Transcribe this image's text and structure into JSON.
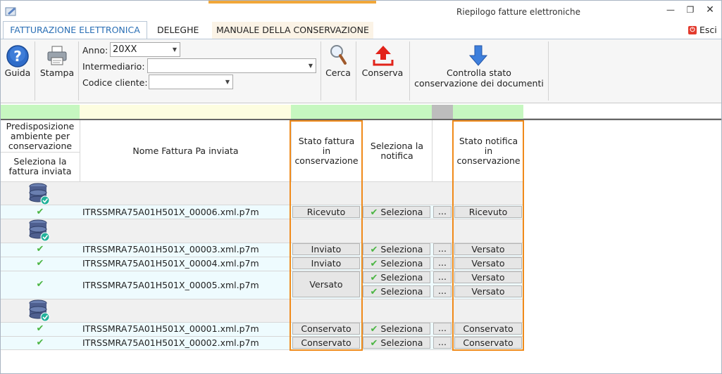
{
  "window": {
    "title": "Riepilogo fatture elettroniche"
  },
  "tabs": [
    {
      "label": "FATTURAZIONE ELETTRONICA"
    },
    {
      "label": "DELEGHE"
    },
    {
      "label": "MANUALE DELLA CONSERVAZIONE"
    }
  ],
  "exit_label": "Esci",
  "ribbon": {
    "guida": "Guida",
    "stampa": "Stampa",
    "anno_label": "Anno:",
    "anno_value": "20XX",
    "intermediario_label": "Intermediario:",
    "intermediario_value": "",
    "codice_label": "Codice cliente:",
    "codice_value": "",
    "cerca": "Cerca",
    "conserva": "Conserva",
    "controlla_line1": "Controlla stato",
    "controlla_line2": "conservazione dei documenti"
  },
  "grid": {
    "headers": {
      "predisposizione": "Predisposizione ambiente per conservazione",
      "seleziona_fattura": "Seleziona la fattura inviata",
      "nome": "Nome Fattura Pa inviata",
      "stato_fattura": "Stato fattura in conservazione",
      "seleziona_notifica": "Seleziona la notifica",
      "stato_notifica": "Stato notifica in conservazione"
    },
    "select_label": "Seleziona",
    "more_label": "...",
    "rows": [
      {
        "name": "ITRSSMRA75A01H501X_00006.xml.p7m",
        "stato": "Ricevuto",
        "notifica": "Ricevuto"
      },
      {
        "name": "ITRSSMRA75A01H501X_00003.xml.p7m",
        "stato": "Inviato",
        "notifica": "Versato"
      },
      {
        "name": "ITRSSMRA75A01H501X_00004.xml.p7m",
        "stato": "Inviato",
        "notifica": "Versato"
      },
      {
        "name": "ITRSSMRA75A01H501X_00005.xml.p7m",
        "stato": "Versato",
        "notifica": "Versato",
        "notifica2": "Versato"
      },
      {
        "name": "ITRSSMRA75A01H501X_00001.xml.p7m",
        "stato": "Conservato",
        "notifica": "Conservato"
      },
      {
        "name": "ITRSSMRA75A01H501X_00002.xml.p7m",
        "stato": "Conservato",
        "notifica": "Conservato"
      }
    ]
  },
  "colors": {
    "accent_tab": "#2a6fb5",
    "highlight": "#f08a1a",
    "row_fill": "#eefbfe",
    "header_green": "#c6f7c0",
    "header_yellow": "#fdfde0"
  }
}
